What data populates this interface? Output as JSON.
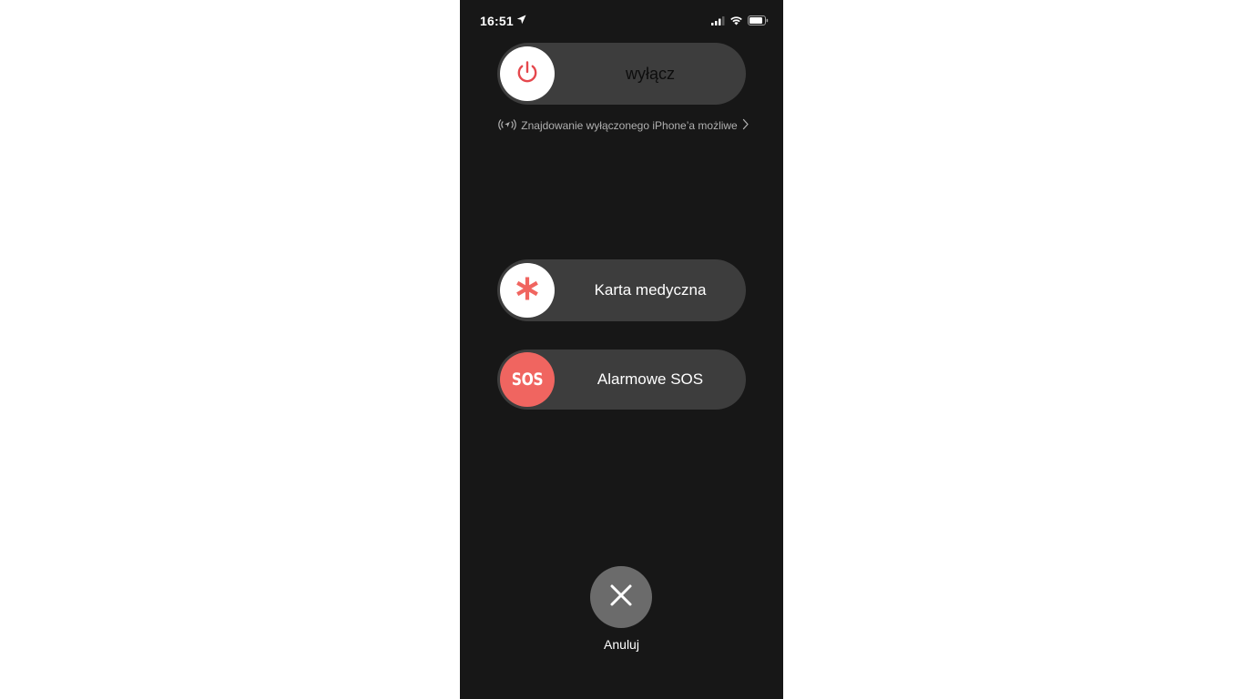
{
  "status_bar": {
    "time": "16:51",
    "icons": [
      "location-arrow-icon",
      "signal-icon",
      "wifi-icon",
      "battery-icon"
    ]
  },
  "power_slider": {
    "label": "wyłącz",
    "icon": "power-icon"
  },
  "find_my": {
    "text": "Znajdowanie wyłączonego iPhone’a możliwe",
    "icon": "find-my-icon"
  },
  "medical_slider": {
    "label": "Karta medyczna",
    "icon": "asterisk-icon"
  },
  "sos_slider": {
    "label": "Alarmowe SOS",
    "knob_text": "SOS"
  },
  "cancel": {
    "label": "Anuluj",
    "icon": "close-icon"
  },
  "colors": {
    "background": "#171717",
    "slider_track": "#3d3d3d",
    "accent_red": "#f06560",
    "power_icon": "#e5484d",
    "cancel_button": "#6b6b6b"
  }
}
